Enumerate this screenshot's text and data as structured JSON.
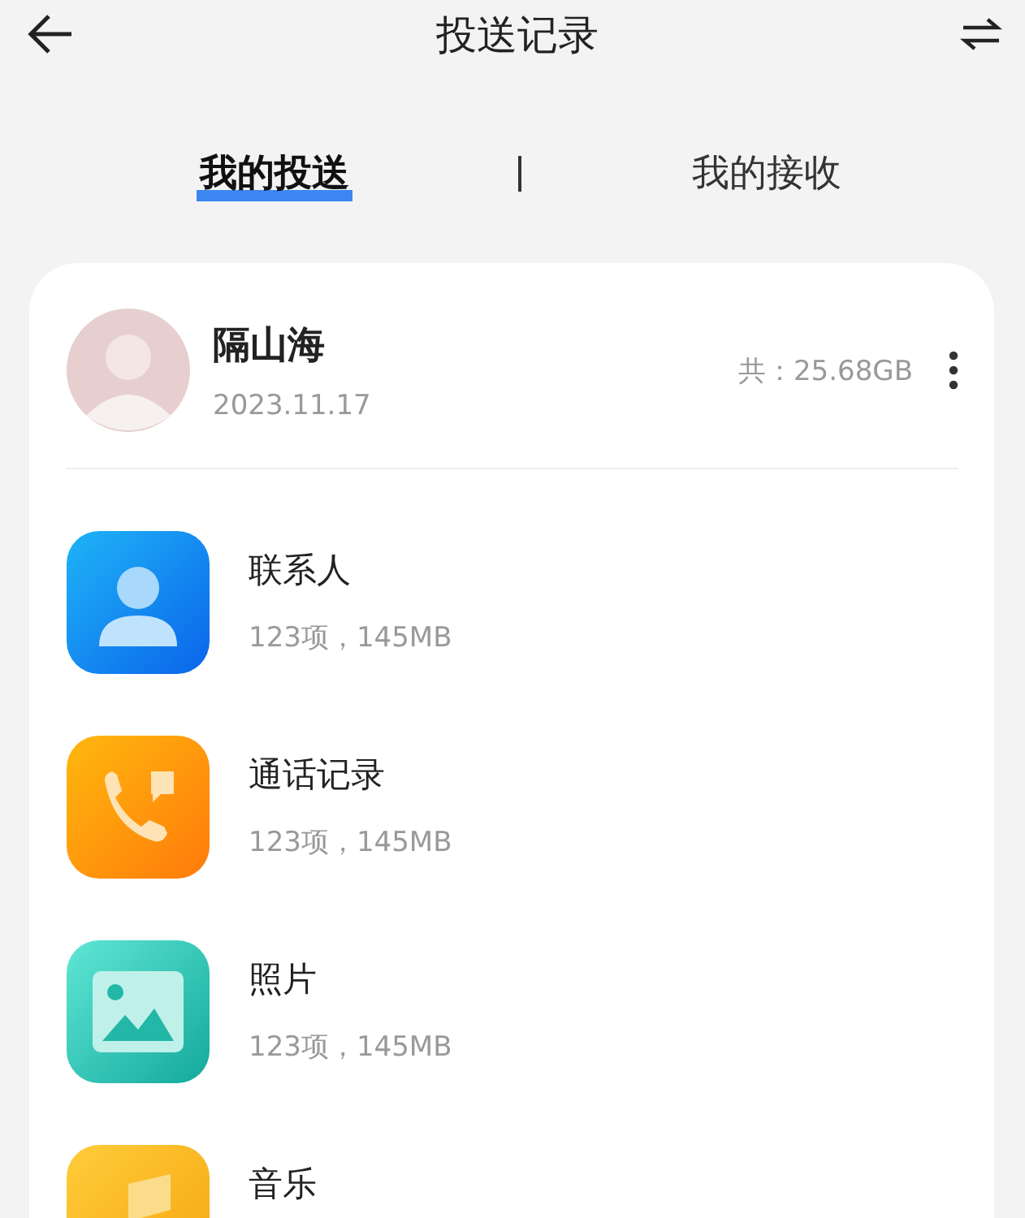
{
  "header": {
    "title": "投送记录"
  },
  "tabs": [
    {
      "label": "我的投送",
      "selected": true
    },
    {
      "label": "我的接收",
      "selected": false
    }
  ],
  "profile": {
    "name": "隔山海",
    "date": "2023.11.17",
    "total": "共：25.68GB"
  },
  "items": [
    {
      "kind": "contacts",
      "title": "联系人",
      "detail": "123项，145MB"
    },
    {
      "kind": "calls",
      "title": "通话记录",
      "detail": "123项，145MB"
    },
    {
      "kind": "photos",
      "title": "照片",
      "detail": "123项，145MB"
    },
    {
      "kind": "music",
      "title": "音乐"
    }
  ]
}
